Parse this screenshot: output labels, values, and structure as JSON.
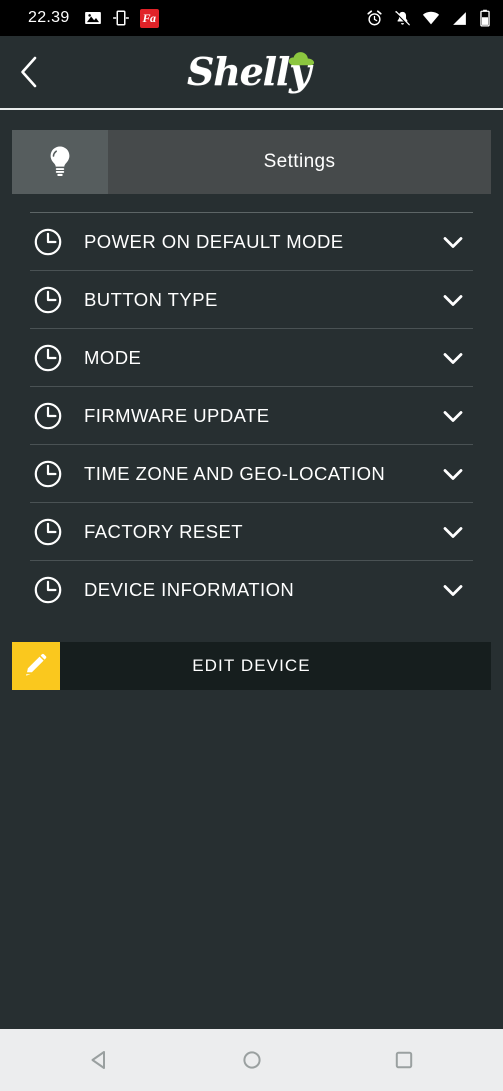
{
  "statusbar": {
    "time": "22.39",
    "left_icons": [
      {
        "name": "image-icon",
        "label": "image"
      },
      {
        "name": "screenshot-icon",
        "label": "screenshot"
      },
      {
        "name": "fa-app-icon",
        "label": "Fa"
      }
    ],
    "right_icons": [
      {
        "name": "alarm-clock-icon",
        "label": "alarm"
      },
      {
        "name": "notifications-off-icon",
        "label": "notifications off"
      },
      {
        "name": "wifi-icon",
        "label": "wifi"
      },
      {
        "name": "cellular-signal-icon",
        "label": "signal"
      },
      {
        "name": "battery-icon",
        "label": "battery"
      }
    ]
  },
  "appbar": {
    "back_label": "Back",
    "logo_text": "Shelly",
    "logo_cloud_color": "#8cc63f"
  },
  "tabs": [
    {
      "id": "device",
      "icon": "lightbulb-icon",
      "label": "",
      "selected": true
    },
    {
      "id": "settings",
      "icon": "",
      "label": "Settings",
      "selected": false
    }
  ],
  "settings_rows": [
    {
      "label": "POWER ON DEFAULT MODE",
      "icon": "clock-icon",
      "chevron": "chevron-down-icon"
    },
    {
      "label": "BUTTON TYPE",
      "icon": "clock-icon",
      "chevron": "chevron-down-icon"
    },
    {
      "label": "MODE",
      "icon": "clock-icon",
      "chevron": "chevron-down-icon"
    },
    {
      "label": "FIRMWARE UPDATE",
      "icon": "clock-icon",
      "chevron": "chevron-down-icon"
    },
    {
      "label": "TIME ZONE AND GEO-LOCATION",
      "icon": "clock-icon",
      "chevron": "chevron-down-icon"
    },
    {
      "label": "FACTORY RESET",
      "icon": "clock-icon",
      "chevron": "chevron-down-icon"
    },
    {
      "label": "DEVICE INFORMATION",
      "icon": "clock-icon",
      "chevron": "chevron-down-icon"
    }
  ],
  "edit_device": {
    "label": "EDIT DEVICE",
    "icon": "pencil-icon",
    "accent_color": "#fac81e"
  },
  "navbar": {
    "back": "back",
    "home": "home",
    "recents": "recents"
  },
  "theme": {
    "background": "#272f31",
    "tab_selected": "#565d5e",
    "tab_bar": "#464a4b",
    "button_bg": "#161e1e",
    "accent": "#fac81e",
    "navbar_bg": "#ecedee"
  }
}
